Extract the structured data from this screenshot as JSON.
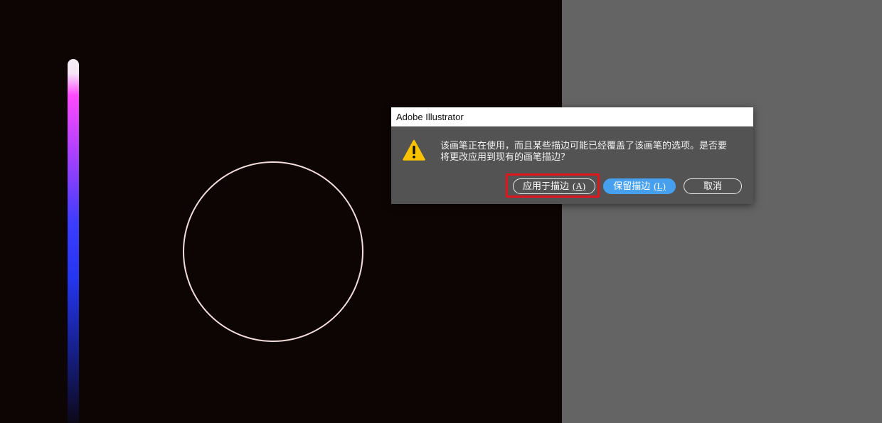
{
  "colors": {
    "artboard": "#0d0504",
    "pasteboard": "#646464",
    "dialog_body": "#535353",
    "dialog_title_bar": "#ffffff",
    "primary_button": "#46a0ee",
    "highlight": "#e3141c",
    "warning": "#f7c200",
    "circle_stroke": "#f2dcdc",
    "brush_gradient": [
      "#f4f0f4",
      "#f6e4f6",
      "#ff4aff",
      "#b040ff",
      "#3c3cff",
      "#2436f0",
      "#16208a",
      "#0c0818"
    ]
  },
  "canvas": {
    "objects": [
      "gradient-brush-stroke",
      "circle-path"
    ]
  },
  "dialog": {
    "title": "Adobe Illustrator",
    "icon": "warning-icon",
    "message_lines": [
      "该画笔正在使用，而且某些描边可能已经覆盖了该画笔的选项。是否要",
      "将更改应用到现有的画笔描边？"
    ],
    "buttons": [
      {
        "label": "应用于描边",
        "shortcut": "(A)",
        "primary": false,
        "highlighted": true
      },
      {
        "label": "保留描边",
        "shortcut": "(L)",
        "primary": true,
        "highlighted": false
      },
      {
        "label": "取消",
        "shortcut": "",
        "primary": false,
        "highlighted": false
      }
    ]
  }
}
